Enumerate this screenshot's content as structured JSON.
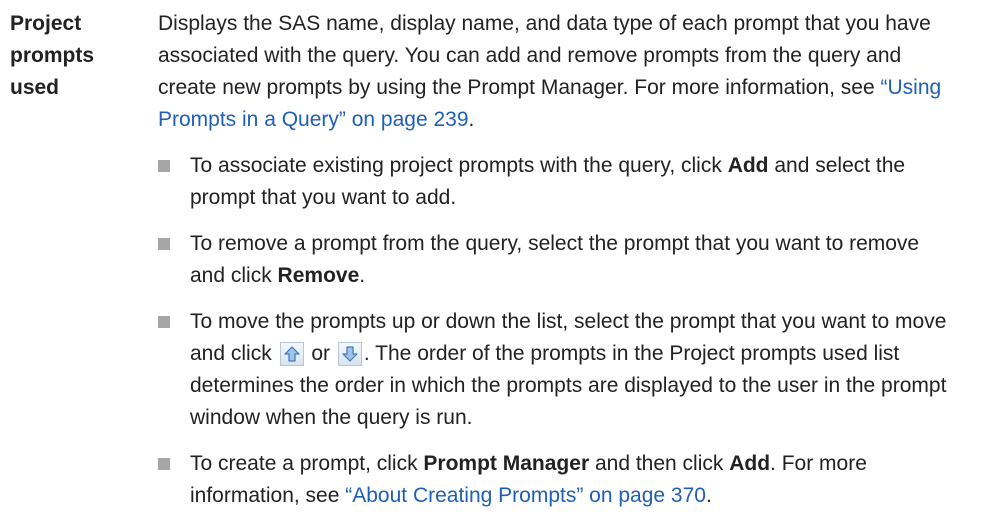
{
  "term": {
    "label": "Project prompts used"
  },
  "description": {
    "text": "Displays the SAS name, display name, and data type of each prompt that you have associated with the query. You can add and remove prompts from the query and create new prompts by using the Prompt Manager. For more information, see ",
    "link": "“Using Prompts in a Query” on page 239",
    "after_link": "."
  },
  "bullets": {
    "associate": {
      "before": "To associate existing project prompts with the query, click ",
      "bold": "Add",
      "after": " and select the prompt that you want to add."
    },
    "remove": {
      "before": "To remove a prompt from the query, select the prompt that you want to remove and click ",
      "bold": "Remove",
      "after": "."
    },
    "move": {
      "before": "To move the prompts up or down the list, select the prompt that you want to move and click ",
      "or": " or ",
      "after": ". The order of the prompts in the Project prompts used list determines the order in which the prompts are displayed to the user in the prompt window when the query is run."
    },
    "create": {
      "before": "To create a prompt, click ",
      "bold1": "Prompt Manager",
      "middle": " and then click ",
      "bold2": "Add",
      "after_bold": ". For more information, see ",
      "link": "“About Creating Prompts” on page 370",
      "after_link": "."
    }
  },
  "icons": {
    "up": "up-arrow-icon",
    "down": "down-arrow-icon"
  },
  "colors": {
    "link": "#1f5fb5",
    "bullet": "#a6a6a6",
    "arrow_fill": "#9ec3ea",
    "arrow_stroke": "#3f78b8"
  }
}
